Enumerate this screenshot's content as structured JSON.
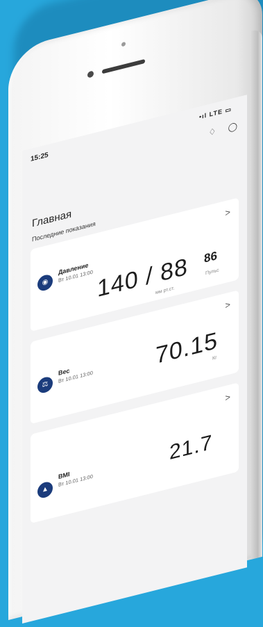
{
  "status_bar": {
    "time": "15:25",
    "indicators": "•ıl LTE ▭"
  },
  "header_icons": {
    "bell": "bell-icon",
    "settings": "settings-icon"
  },
  "page_title": "Главная",
  "section_label": "Последние показания",
  "cards": [
    {
      "name": "Давление",
      "date": "Вт 10.01 13:00",
      "value": "140 / 88",
      "unit": "мм рт.ст.",
      "pulse_value": "86",
      "pulse_unit": "Пульс",
      "chevron": ">"
    },
    {
      "name": "Вес",
      "date": "Вт 10.01 13:00",
      "value": "70.15",
      "unit": "Кг",
      "chevron": ">"
    },
    {
      "name": "BMI",
      "date": "Вт 10.01 13:00",
      "value": "21.7",
      "chevron": ">"
    }
  ],
  "colors": {
    "background": "#27a7dc",
    "screen": "#f3f3f4",
    "card_icon": "#1b3c7c"
  }
}
